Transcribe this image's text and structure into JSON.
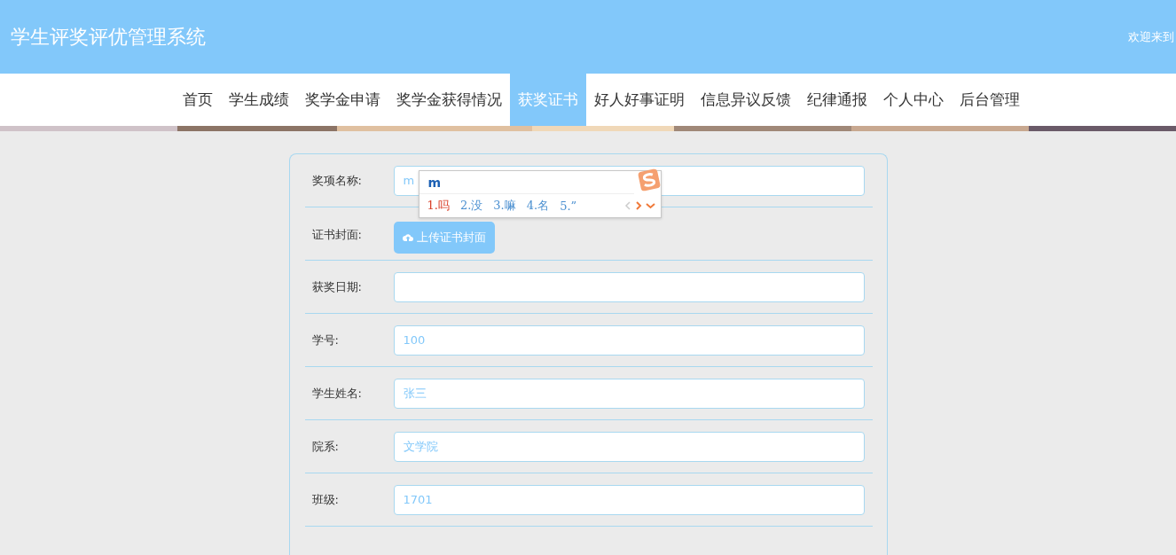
{
  "header": {
    "title": "学生评奖评优管理系统",
    "welcome": "欢迎来到"
  },
  "nav": [
    {
      "label": "首页",
      "selected": false
    },
    {
      "label": "学生成绩",
      "selected": false
    },
    {
      "label": "奖学金申请",
      "selected": false
    },
    {
      "label": "奖学金获得情况",
      "selected": false
    },
    {
      "label": "获奖证书",
      "selected": true
    },
    {
      "label": "好人好事证明",
      "selected": false
    },
    {
      "label": "信息异议反馈",
      "selected": false
    },
    {
      "label": "纪律通报",
      "selected": false
    },
    {
      "label": "个人中心",
      "selected": false
    },
    {
      "label": "后台管理",
      "selected": false
    }
  ],
  "form": [
    {
      "kind": "input",
      "label": "奖项名称:",
      "value": "m"
    },
    {
      "kind": "upload",
      "label": "证书封面:",
      "button": "上传证书封面"
    },
    {
      "kind": "input",
      "label": "获奖日期:"
    },
    {
      "kind": "input",
      "label": "学号:",
      "value": "100"
    },
    {
      "kind": "input",
      "label": "学生姓名:",
      "value": "张三"
    },
    {
      "kind": "input",
      "label": "院系:",
      "value": "文学院"
    },
    {
      "kind": "input",
      "label": "班级:",
      "value": "1701"
    }
  ],
  "ime": {
    "composition": "m",
    "candidates": [
      {
        "label": "1.吗",
        "selected": true
      },
      {
        "label": "2.没",
        "selected": false
      },
      {
        "label": "3.嘛",
        "selected": false
      },
      {
        "label": "4.名",
        "selected": false
      },
      {
        "label": "5.”",
        "selected": false
      }
    ]
  }
}
